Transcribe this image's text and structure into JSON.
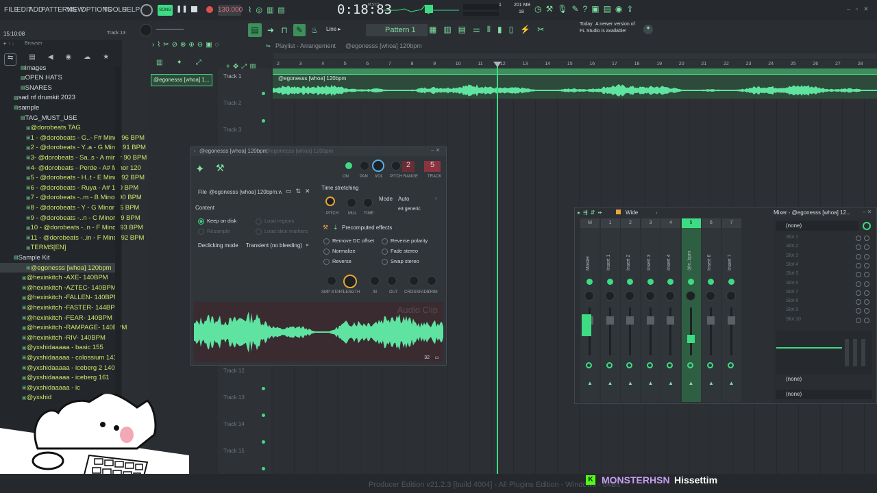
{
  "menu": [
    "FILE",
    "EDIT",
    "ADD",
    "PATTERNS",
    "VIEW",
    "OPTIONS",
    "TOOLS",
    "HELP"
  ],
  "transport": {
    "mode_label": "SONG",
    "bpm": "130.000",
    "time": "0:18:83",
    "time_unit_label": "M:S:CS",
    "cpu_value": "1",
    "ram_value": "201 MB",
    "poly_value": "18"
  },
  "status": {
    "clock": "15:10:08",
    "track_hint": "Track 13",
    "snap": "Line",
    "pattern": "Pattern 1"
  },
  "news": {
    "line1": "Today",
    "line2": "A newer version of",
    "line3": "FL Studio is available!"
  },
  "browser": {
    "title": "Browser",
    "items": [
      {
        "label": "images",
        "type": "folder"
      },
      {
        "label": "OPEN HATS",
        "type": "folder"
      },
      {
        "label": "SNARES",
        "type": "folder"
      },
      {
        "label": "sad nf drumkit 2023",
        "type": "folder"
      },
      {
        "label": "sample",
        "type": "folder"
      },
      {
        "label": "TAG_MUST_USE",
        "type": "folder"
      },
      {
        "label": "@dorobeats TAG",
        "type": "file"
      },
      {
        "label": "1 - @dorobeats - G..- F# Minor 96 BPM",
        "type": "file"
      },
      {
        "label": "2 - @dorobeats - Y..a - G Minor 91 BPM",
        "type": "file"
      },
      {
        "label": "3- @dorobeats - Sa..s - A minor 90 BPM",
        "type": "file"
      },
      {
        "label": "4- @dorobeats - Perde - A# Minor 120",
        "type": "file"
      },
      {
        "label": "5 - @dorobeats - H..t - E Minor 92 BPM",
        "type": "file"
      },
      {
        "label": "6 - @dorobeats - Ruya - A# 120 BPM",
        "type": "file"
      },
      {
        "label": "7 - @dorobeats -..m - B Minor 90 BPM",
        "type": "file"
      },
      {
        "label": "8 - @dorobeats - Y - G Minor 95 BPM",
        "type": "file"
      },
      {
        "label": "9 - @dorobeats -..n - C Minor 89 BPM",
        "type": "file"
      },
      {
        "label": "10 - @dorobeats -..n - F Minor 93 BPM",
        "type": "file"
      },
      {
        "label": "11 - @dorobeats -..in - F Minor 92 BPM",
        "type": "file"
      },
      {
        "label": "TERMS[EN]",
        "type": "file"
      },
      {
        "label": "Sample Kit",
        "type": "folder"
      },
      {
        "label": "@egonesss [whoa] 120bpm",
        "type": "file"
      },
      {
        "label": "@hexinkitch -AXE- 140BPM",
        "type": "file"
      },
      {
        "label": "@hexinkitch -AZTEC- 140BPM",
        "type": "file"
      },
      {
        "label": "@hexinkitch -FALLEN- 140BPM",
        "type": "file"
      },
      {
        "label": "@hexinkitch -FASTER- 144BPM",
        "type": "file"
      },
      {
        "label": "@hexinkitch -FEAR- 140BPM",
        "type": "file"
      },
      {
        "label": "@hexinkitch -RAMPAGE- 140BPM",
        "type": "file"
      },
      {
        "label": "@hexinkitch -RIV- 140BPM",
        "type": "file"
      },
      {
        "label": "@yxshidaaaaa - basic 155",
        "type": "file"
      },
      {
        "label": "@yxshidaaaaa - colossium 141",
        "type": "file"
      },
      {
        "label": "@yxshidaaaaa - iceberg 2 140",
        "type": "file"
      },
      {
        "label": "@yxshidaaaaa - iceberg 161",
        "type": "file"
      },
      {
        "label": "@yxshidaaaaa - ic",
        "type": "file"
      },
      {
        "label": "@yxshid",
        "type": "file"
      }
    ]
  },
  "playlist": {
    "title": "Playlist - Arrangement",
    "pattern_name": "@egonesss [whoa] 120bpm",
    "picker_clip": "@egonesss [whoa] 1...",
    "clip_label": "@egonesss [whoa] 120bpm",
    "bars": [
      "2",
      "3",
      "4",
      "5",
      "6",
      "7",
      "8",
      "9",
      "10",
      "11",
      "12",
      "13",
      "14",
      "15",
      "16",
      "17",
      "18",
      "19",
      "20",
      "21",
      "22",
      "23",
      "24",
      "25",
      "26",
      "27",
      "28"
    ],
    "tracks": [
      "Track 1",
      "Track 2",
      "Track 3",
      "Track 12",
      "Track 13",
      "Track 14",
      "Track 15"
    ]
  },
  "channel": {
    "title": "@egonesss [whoa] 120bpm",
    "title_sub": "@egonesss [whoa] 120bpm",
    "knob_labels": [
      "ON",
      "PAN",
      "VOL",
      "PITCH RANGE",
      "TRACK"
    ],
    "pitch_range": "2",
    "track_num": "5",
    "file_label": "File",
    "file_value": "@egonesss [whoa] 120bpm.wav",
    "content_label": "Content",
    "keep_on_disk": "Keep on disk",
    "resample": "Resample",
    "load_regions": "Load regions",
    "load_slice": "Load slice markers",
    "declick_label": "Declicking mode",
    "declick_value": "Transient (no bleeding)",
    "ts_label": "Time stretching",
    "mode_label": "Mode",
    "mode_value": "Auto",
    "e3": "e3 generic",
    "ts_knobs": [
      "PITCH",
      "MUL",
      "TIME"
    ],
    "precomp": "Precomputed effects",
    "effects": [
      "Remove DC offset",
      "Reverse polarity",
      "Normalize",
      "Fade stereo",
      "Reverse",
      "Swap stereo"
    ],
    "bottom_knobs": [
      "SMP START",
      "LENGTH",
      "IN",
      "OUT",
      "CROSSFADE",
      "TRIM"
    ],
    "audio_clip": "Audio Clip",
    "zoom": "32"
  },
  "mixer": {
    "preset": "Wide",
    "title": "Mixer - @egonesss [whoa] 12...",
    "strips": [
      "Master",
      "Insert 1",
      "Insert 2",
      "Insert 3",
      "Insert 4",
      "@e..bpm",
      "Insert 6",
      "Insert 7"
    ],
    "strip_numbers": [
      "M",
      "1",
      "2",
      "3",
      "4",
      "5",
      "6",
      "7"
    ],
    "none_label": "(none)",
    "slots": [
      "Slot 1",
      "Slot 2",
      "Slot 3",
      "Slot 4",
      "Slot 5",
      "Slot 6",
      "Slot 7",
      "Slot 8",
      "Slot 9",
      "Slot 10"
    ],
    "eq_none": "(none)",
    "out_none": "(none)"
  },
  "footer": {
    "edition": "Producer Edition v21.2.3 [build 4004] - All Plugins Edition - Windows - 64Bit",
    "chat_user": "MONSTERHSN",
    "chat_msg": "Hissettim",
    "badge": "K"
  },
  "colors": {
    "accent": "#3ddc84",
    "waveform": "#5fe3a1",
    "bg": "#2b2f33",
    "panel": "#23272b"
  }
}
